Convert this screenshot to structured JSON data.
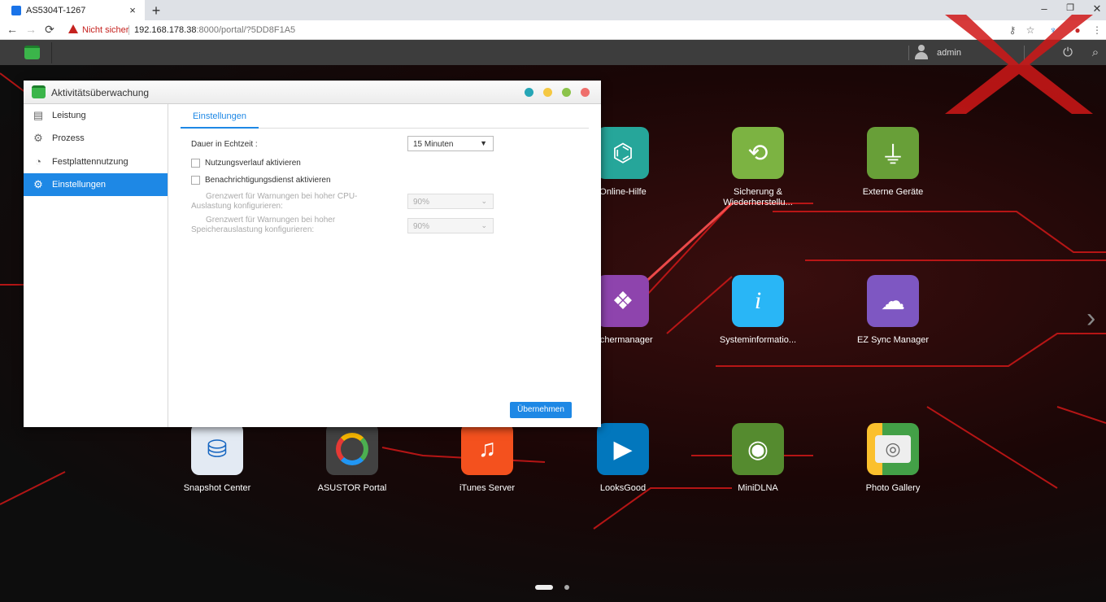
{
  "browser": {
    "tab_title": "AS5304T-1267",
    "tab_close": "×",
    "new_tab": "+",
    "win_minimize": "–",
    "win_restore": "❐",
    "win_close": "✕",
    "back": "←",
    "forward": "→",
    "reload": "⟳",
    "security_warning": "Nicht sicher",
    "url_host": "192.168.178.38",
    "url_rest": ":8000/portal/?5DD8F1A5"
  },
  "adm": {
    "username": "admin"
  },
  "window": {
    "title": "Aktivitätsüberwachung",
    "sidebar": [
      {
        "label": "Leistung",
        "icon": "chart-icon"
      },
      {
        "label": "Prozess",
        "icon": "gears-icon"
      },
      {
        "label": "Festplattennutzung",
        "icon": "disk-icon"
      },
      {
        "label": "Einstellungen",
        "icon": "gear-icon"
      }
    ],
    "tab": "Einstellungen",
    "duration_label": "Dauer in Echtzeit :",
    "duration_value": "15 Minuten",
    "usage_history_label": "Nutzungsverlauf aktivieren",
    "notification_label": "Benachrichtigungsdienst aktivieren",
    "cpu_threshold_label": "Grenzwert für Warnungen bei hoher CPU-Auslastung konfigurieren:",
    "cpu_threshold_value": "90%",
    "mem_threshold_label": "Grenzwert für Warnungen bei hoher Speicherauslastung konfigurieren:",
    "mem_threshold_value": "90%",
    "apply_button": "Übernehmen"
  },
  "desktop": {
    "apps": [
      {
        "label": "Online-Hilfe",
        "icon": "help-book-icon",
        "color": "#26a69a"
      },
      {
        "label": "Sicherung & Wiederherstellu...",
        "icon": "backup-icon",
        "color": "#7cb342"
      },
      {
        "label": "Externe Geräte",
        "icon": "usb-icon",
        "color": "#689f38"
      },
      {
        "label": "eichermanager",
        "icon": "storage-manager-icon",
        "color": "#8e44ad"
      },
      {
        "label": "Systeminformatio...",
        "icon": "info-icon",
        "color": "#29b6f6"
      },
      {
        "label": "EZ Sync Manager",
        "icon": "ezsync-icon",
        "color": "#7e57c2"
      },
      {
        "label": "Snapshot Center",
        "icon": "snapshot-icon",
        "color": "#1565c0"
      },
      {
        "label": "ASUSTOR Portal",
        "icon": "portal-icon",
        "color": "#424242"
      },
      {
        "label": "iTunes Server",
        "icon": "music-icon",
        "color": "#f4511e"
      },
      {
        "label": "LooksGood",
        "icon": "looksgood-icon",
        "color": "#0277bd"
      },
      {
        "label": "MiniDLNA",
        "icon": "dlna-icon",
        "color": "#558b2f"
      },
      {
        "label": "Photo Gallery",
        "icon": "camera-icon",
        "color": "#43a047"
      }
    ]
  }
}
